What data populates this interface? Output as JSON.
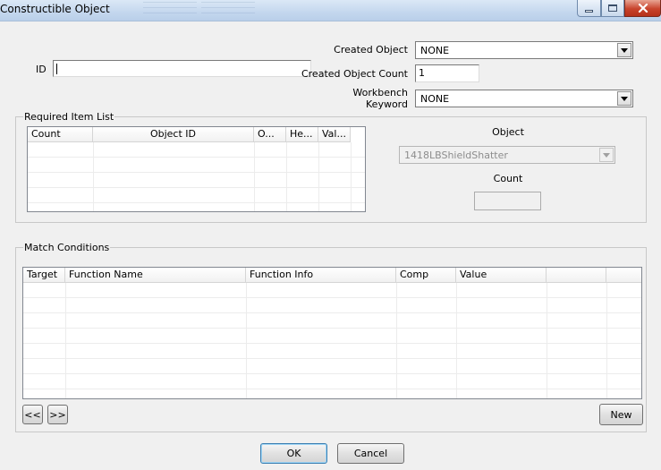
{
  "window": {
    "title": "Constructible Object",
    "buttons": {
      "minimize": "minimize",
      "maximize": "maximize",
      "close": "close"
    }
  },
  "form": {
    "id_label": "ID",
    "id_value": "",
    "created_object_label": "Created Object",
    "created_object_value": "NONE",
    "created_object_count_label": "Created Object Count",
    "created_object_count_value": "1",
    "workbench_keyword_label_line1": "Workbench",
    "workbench_keyword_label_line2": "Keyword",
    "workbench_keyword_value": "NONE"
  },
  "required_items": {
    "legend": "Required Item List",
    "columns": [
      "Count",
      "Object ID",
      "O...",
      "He...",
      "Val..."
    ],
    "rows": [],
    "object_label": "Object",
    "object_value": "1418LBShieldShatter",
    "count_label": "Count",
    "count_value": ""
  },
  "match_conditions": {
    "legend": "Match Conditions",
    "columns": [
      "Target",
      "Function Name",
      "Function Info",
      "Comp",
      "Value",
      "",
      ""
    ],
    "rows": [],
    "prev_button": "<<",
    "next_button": ">>",
    "new_button": "New"
  },
  "footer": {
    "ok_button": "OK",
    "cancel_button": "Cancel"
  },
  "colors": {
    "dialog_bg": "#f0f0f0",
    "titlebar": "#c4d7ee",
    "close_button": "#c8432c"
  }
}
